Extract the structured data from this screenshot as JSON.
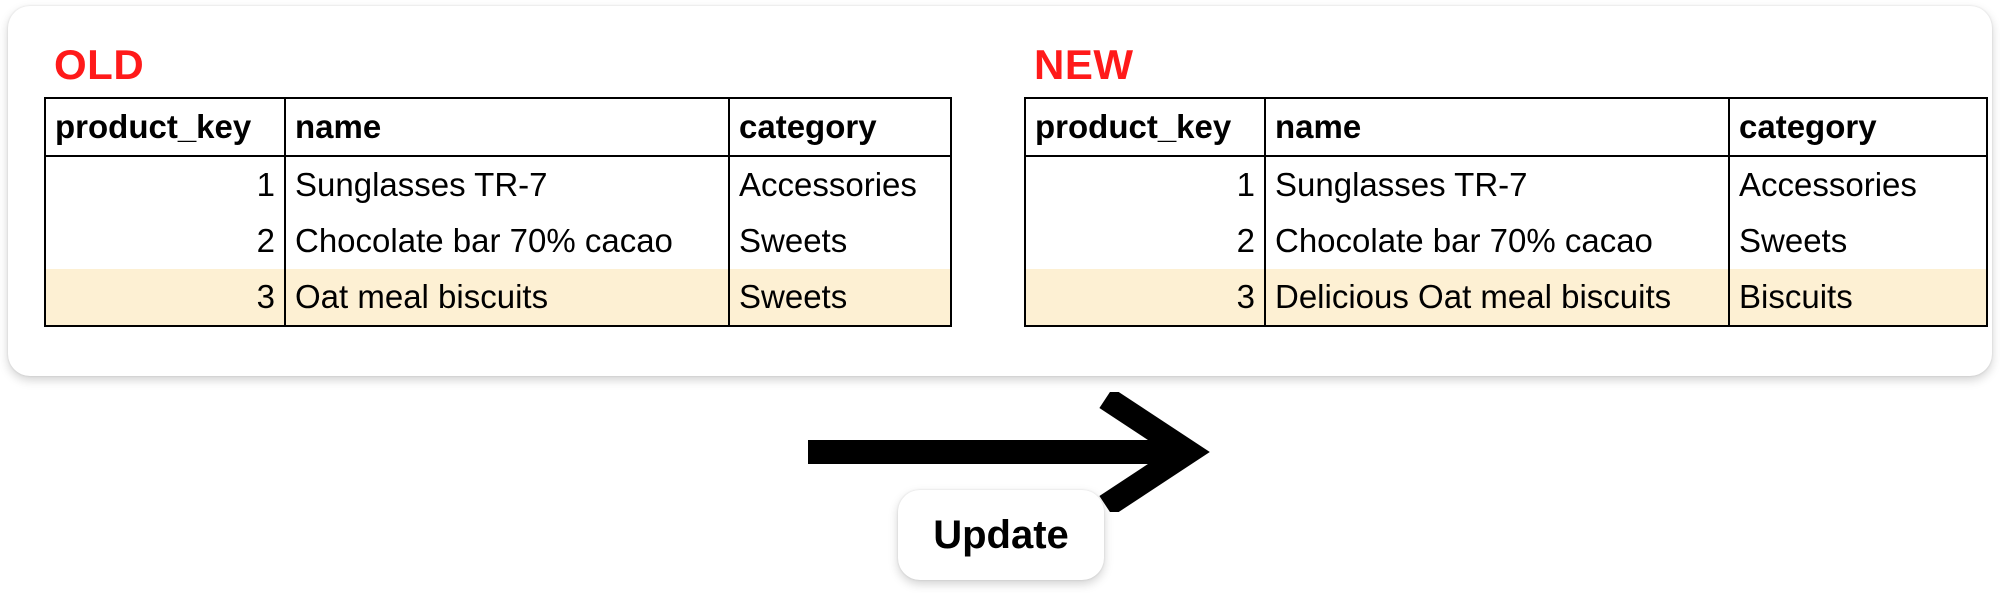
{
  "accent_color": "#ff1a1a",
  "highlight_color": "#fdf0d3",
  "old_table": {
    "title": "OLD",
    "columns": [
      "product_key",
      "name",
      "category"
    ],
    "rows": [
      [
        "1",
        "Sunglasses TR-7",
        "Accessories"
      ],
      [
        "2",
        "Chocolate bar 70% cacao",
        "Sweets"
      ],
      [
        "3",
        "Oat meal biscuits",
        "Sweets"
      ]
    ],
    "highlighted_row": 3
  },
  "new_table": {
    "title": "NEW",
    "columns": [
      "product_key",
      "name",
      "category"
    ],
    "rows": [
      [
        "1",
        "Sunglasses TR-7",
        "Accessories"
      ],
      [
        "2",
        "Chocolate bar 70% cacao",
        "Sweets"
      ],
      [
        "3",
        "Delicious Oat meal biscuits",
        "Biscuits"
      ]
    ],
    "highlighted_row": 3
  },
  "arrow": {
    "icon": "right-arrow-icon",
    "label": "Update"
  }
}
